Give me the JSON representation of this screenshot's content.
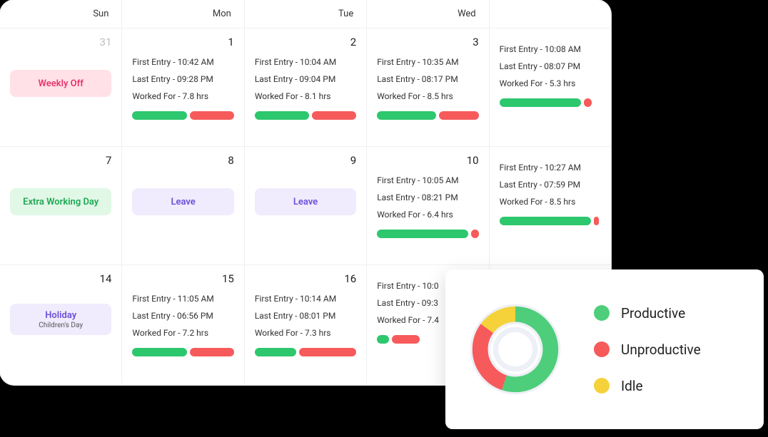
{
  "headers": [
    "Sun",
    "Mon",
    "Tue",
    "Wed",
    ""
  ],
  "weeks": [
    [
      {
        "date": "31",
        "muted": true,
        "badge": {
          "type": "weekly-off",
          "text": "Weekly Off"
        }
      },
      {
        "date": "1",
        "first": "First Entry - 10:42 AM",
        "last": "Last Entry - 09:28 PM",
        "worked": "Worked For - 7.8 hrs",
        "bar": [
          55,
          45
        ]
      },
      {
        "date": "2",
        "first": "First Entry - 10:04 AM",
        "last": "Last Entry - 09:04 PM",
        "worked": "Worked For - 8.1 hrs",
        "bar": [
          55,
          45
        ]
      },
      {
        "date": "3",
        "first": "First Entry - 10:35 AM",
        "last": "Last Entry - 08:17 PM",
        "worked": "Worked For - 8.5 hrs",
        "bar": [
          60,
          40
        ]
      },
      {
        "date": "",
        "first": "First Entry - 10:08 AM",
        "last": "Last Entry - 08:07 PM",
        "worked": "Worked For - 5.3 hrs",
        "bar": [
          80,
          8
        ],
        "clipped": true
      }
    ],
    [
      {
        "date": "7",
        "badge": {
          "type": "extra",
          "text": "Extra Working Day"
        }
      },
      {
        "date": "8",
        "badge": {
          "type": "leave",
          "text": "Leave"
        }
      },
      {
        "date": "9",
        "badge": {
          "type": "leave",
          "text": "Leave"
        }
      },
      {
        "date": "10",
        "first": "First Entry - 10:05 AM",
        "last": "Last Entry - 08:21 PM",
        "worked": "Worked For - 6.4 hrs",
        "bar": [
          92,
          8
        ]
      },
      {
        "date": "",
        "first": "First Entry - 10:27 AM",
        "last": "Last Entry - 07:59 PM",
        "worked": "Worked For - 8.5 hrs",
        "bar": [
          90,
          5
        ],
        "clipped": true
      }
    ],
    [
      {
        "date": "14",
        "badge": {
          "type": "holiday",
          "text": "Holiday",
          "sub": "Children's Day"
        }
      },
      {
        "date": "15",
        "first": "First Entry - 11:05 AM",
        "last": "Last Entry - 06:56 PM",
        "worked": "Worked For - 7.2 hrs",
        "bar": [
          55,
          45
        ]
      },
      {
        "date": "16",
        "first": "First Entry - 10:14 AM",
        "last": "Last Entry - 08:01 PM",
        "worked": "Worked For - 7.3 hrs",
        "bar": [
          42,
          58
        ]
      },
      {
        "date": "",
        "first": "First Entry - 10:0",
        "last": "Last Entry - 09:3",
        "worked": "Worked For - 7.4",
        "bar": [
          20,
          45
        ],
        "partial": true
      },
      {
        "date": "",
        "empty": true
      }
    ]
  ],
  "legend": {
    "items": [
      {
        "color": "g",
        "label": "Productive"
      },
      {
        "color": "r",
        "label": "Unproductive"
      },
      {
        "color": "y",
        "label": "Idle"
      }
    ]
  },
  "chart_data": {
    "type": "pie",
    "title": "",
    "series": [
      {
        "name": "Productive",
        "value": 55,
        "color": "#4ece7a"
      },
      {
        "name": "Unproductive",
        "value": 30,
        "color": "#f75a5a"
      },
      {
        "name": "Idle",
        "value": 15,
        "color": "#f5d23a"
      }
    ]
  }
}
